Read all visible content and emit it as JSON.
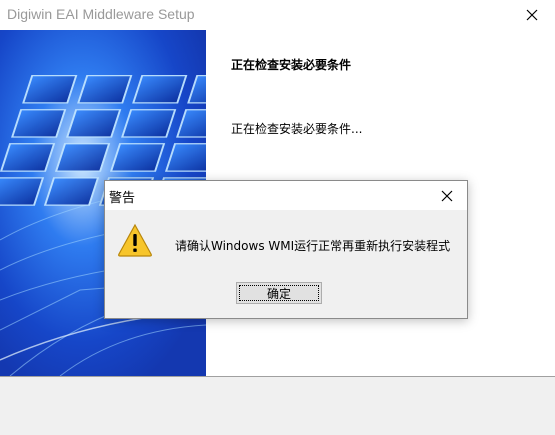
{
  "window": {
    "title": "Digiwin EAI Middleware Setup",
    "heading": "正在检查安装必要条件",
    "status": "正在检查安装必要条件..."
  },
  "dialog": {
    "title": "警告",
    "message": "请确认Windows WMI运行正常再重新执行安装程式",
    "ok_label": "确定"
  },
  "icons": {
    "window_close": "close-icon",
    "dialog_close": "close-icon",
    "warning": "warning-icon"
  },
  "colors": {
    "title_text": "#999999",
    "panel_bg": "#f0f0f0",
    "banner_blue": "#1b4fd6",
    "warning_yellow": "#f7c52b"
  }
}
